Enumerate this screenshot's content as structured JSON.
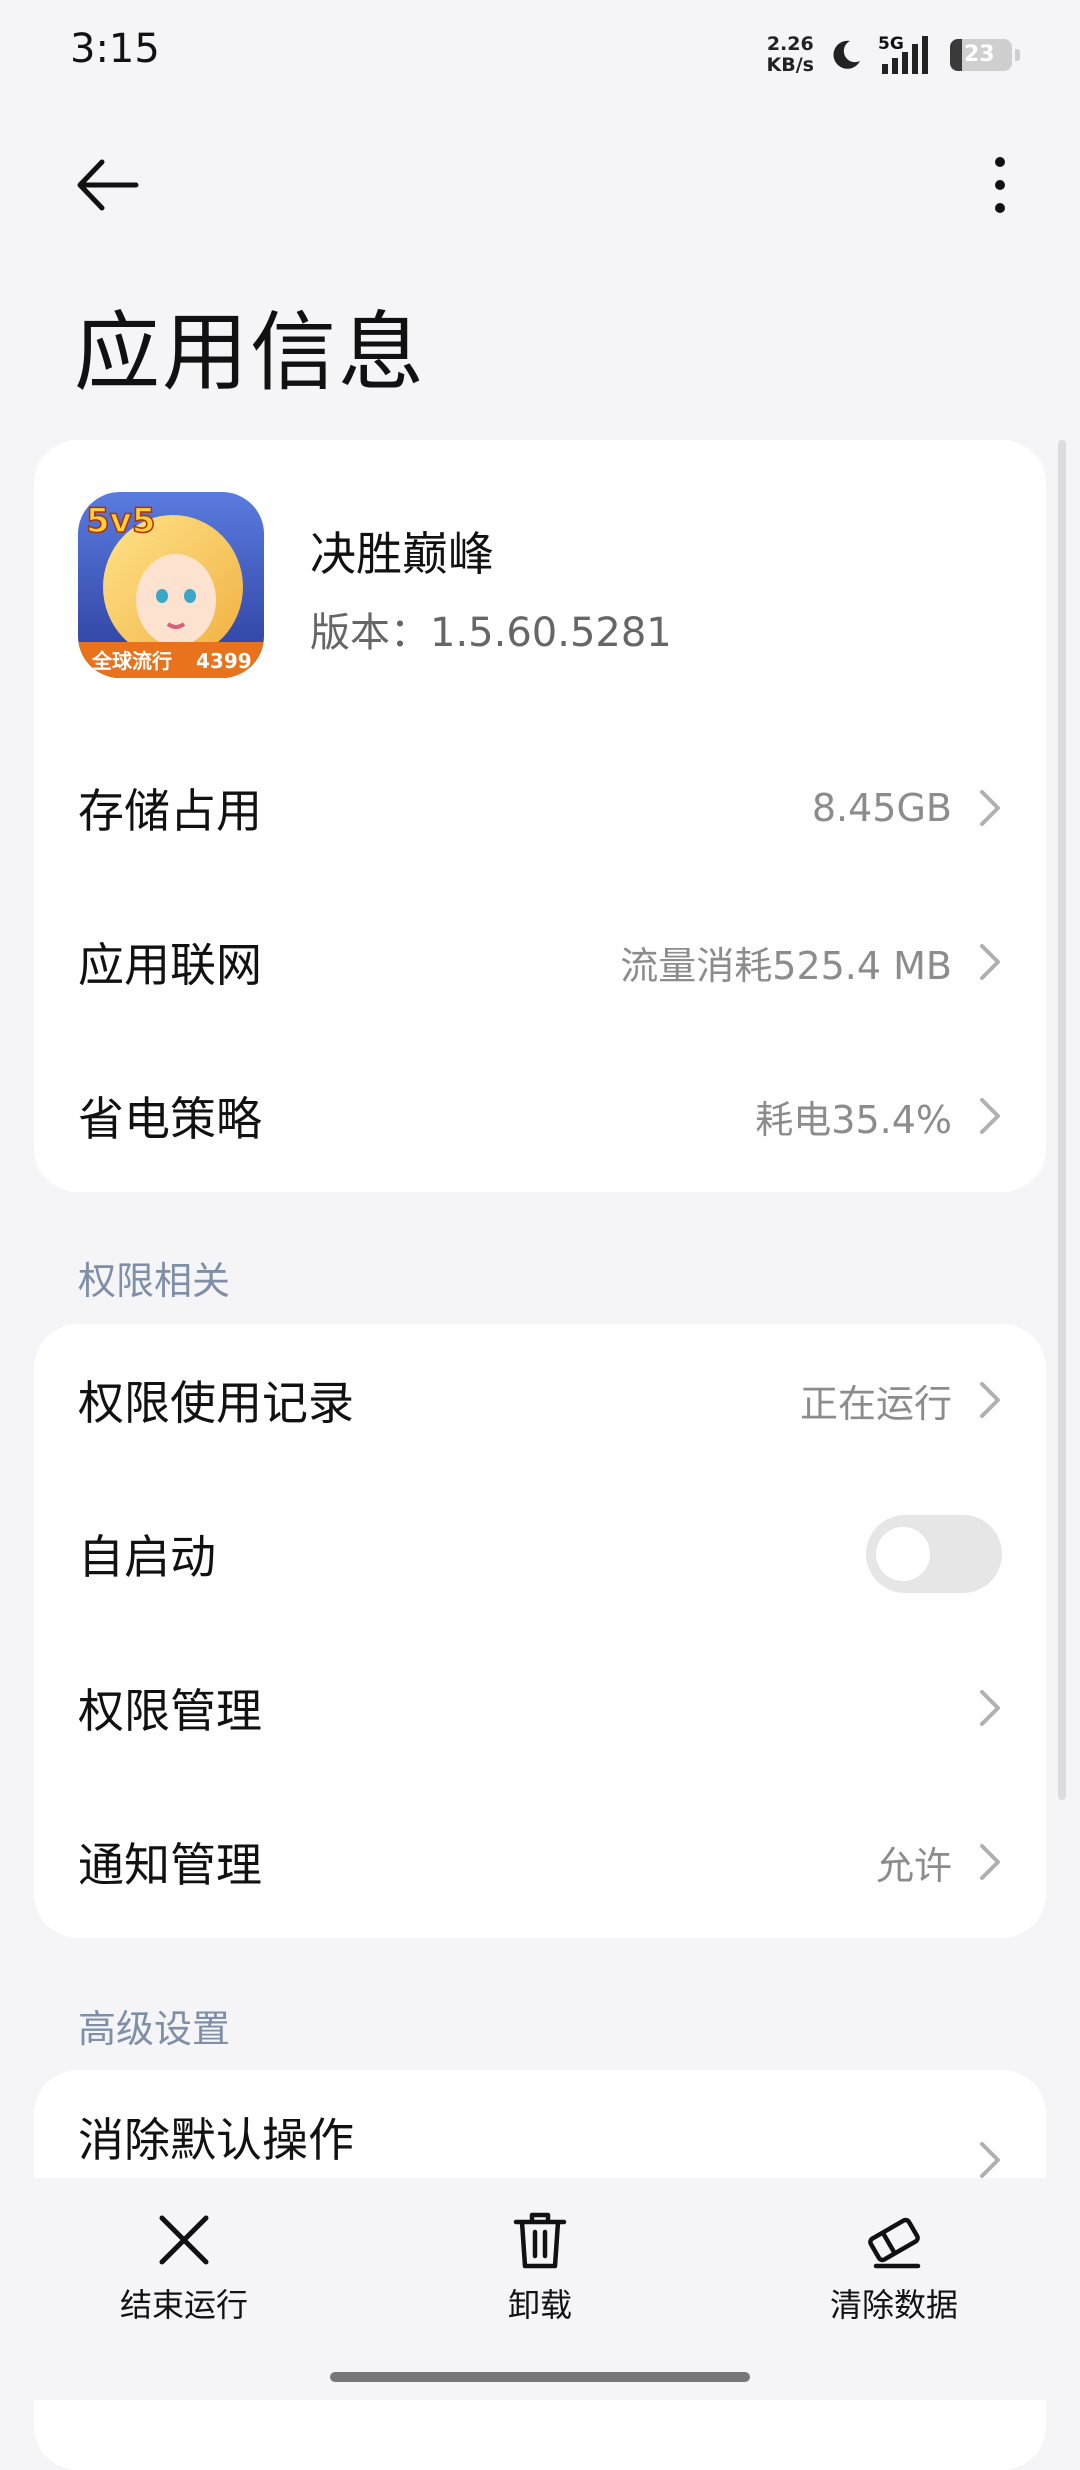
{
  "status": {
    "time": "3:15",
    "net_speed_value": "2.26",
    "net_speed_unit": "KB/s",
    "network_type": "5G",
    "battery": "23"
  },
  "page": {
    "title": "应用信息"
  },
  "app": {
    "name": "决胜巅峰",
    "version": "版本：1.5.60.5281",
    "icon_badge": "5v5",
    "icon_banner": "全球流行",
    "icon_number": "4399"
  },
  "info_rows": [
    {
      "label": "存储占用",
      "value": "8.45GB"
    },
    {
      "label": "应用联网",
      "value": "流量消耗525.4 MB"
    },
    {
      "label": "省电策略",
      "value": "耗电35.4%"
    }
  ],
  "sections": {
    "permissions": "权限相关",
    "advanced": "高级设置"
  },
  "perm_rows": [
    {
      "label": "权限使用记录",
      "value": "正在运行"
    },
    {
      "label": "自启动",
      "toggle_on": false
    },
    {
      "label": "权限管理",
      "value": ""
    },
    {
      "label": "通知管理",
      "value": "允许"
    }
  ],
  "adv_rows": [
    {
      "label": "消除默认操作"
    }
  ],
  "actions": {
    "stop": "结束运行",
    "uninstall": "卸载",
    "clear": "清除数据"
  },
  "colors": {
    "background": "#f5f5f7",
    "card": "#ffffff",
    "section_title": "#7f8fa8",
    "secondary_text": "#8c8c8c"
  }
}
